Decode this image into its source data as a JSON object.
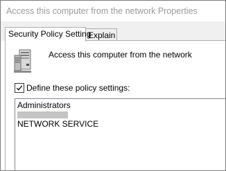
{
  "window": {
    "title": "Access this computer from the network Properties"
  },
  "tabs": [
    {
      "label": "Security Policy Setting",
      "selected": true
    },
    {
      "label": "Explain",
      "selected": false
    }
  ],
  "policy": {
    "icon": "server-computer-icon",
    "name": "Access this computer from the network"
  },
  "define_checkbox": {
    "label": "Define these policy settings:",
    "checked": true
  },
  "accounts": [
    {
      "label": "Administrators"
    },
    {
      "label": "",
      "redacted": true
    },
    {
      "label": "NETWORK SERVICE"
    }
  ],
  "colors": {
    "title_text": "#9a9a9a",
    "tabstrip_bg": "#f0f0f0",
    "redaction": "#c4c4c4"
  }
}
